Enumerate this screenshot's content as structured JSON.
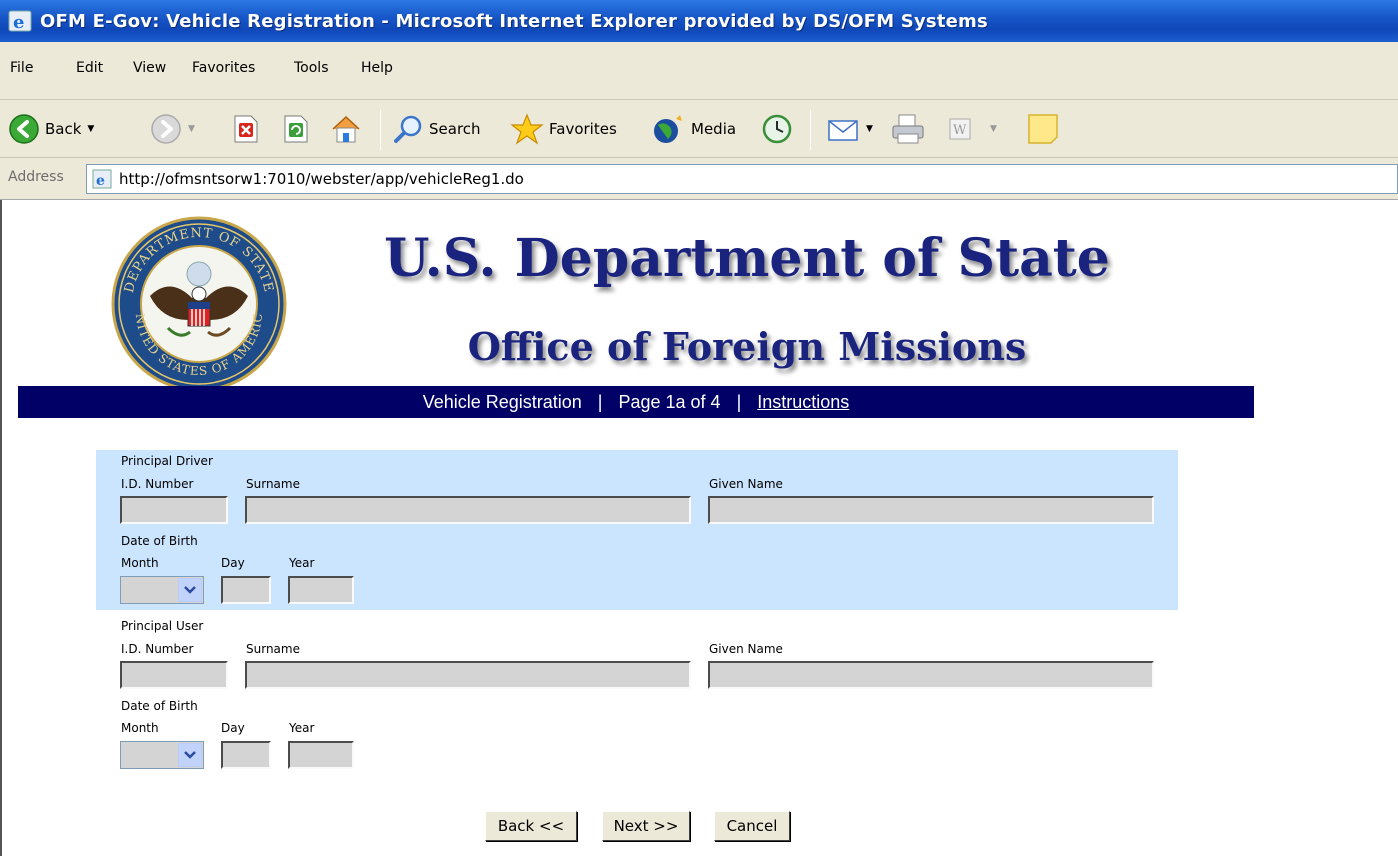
{
  "window": {
    "title": "OFM E-Gov: Vehicle Registration - Microsoft Internet Explorer provided by DS/OFM Systems"
  },
  "menu": [
    "File",
    "Edit",
    "View",
    "Favorites",
    "Tools",
    "Help"
  ],
  "toolbar": {
    "back_label": "Back",
    "search_label": "Search",
    "favorites_label": "Favorites",
    "media_label": "Media"
  },
  "address": {
    "label": "Address",
    "url": "http://ofmsntsorw1:7010/webster/app/vehicleReg1.do"
  },
  "header": {
    "title": "U.S. Department of State",
    "subtitle": "Office of Foreign Missions",
    "seal_text_top": "DEPARTMENT OF STATE",
    "seal_text_bottom": "UNITED STATES OF AMERICA"
  },
  "nav": {
    "section": "Vehicle Registration",
    "separator": "|",
    "page": "Page 1a of 4",
    "instructions_link": "Instructions"
  },
  "driver": {
    "heading": "Principal Driver",
    "id_label": "I.D. Number",
    "surname_label": "Surname",
    "given_label": "Given Name",
    "dob_label": "Date of Birth",
    "month_label": "Month",
    "day_label": "Day",
    "year_label": "Year"
  },
  "user": {
    "heading": "Principal User",
    "id_label": "I.D. Number",
    "surname_label": "Surname",
    "given_label": "Given Name",
    "dob_label": "Date of Birth",
    "month_label": "Month",
    "day_label": "Day",
    "year_label": "Year"
  },
  "buttons": {
    "back": "Back <<",
    "next": "Next >>",
    "cancel": "Cancel"
  },
  "colors": {
    "nav_band": "#000066",
    "heading_blue": "#1a237e",
    "driver_panel": "#cce5ff"
  }
}
